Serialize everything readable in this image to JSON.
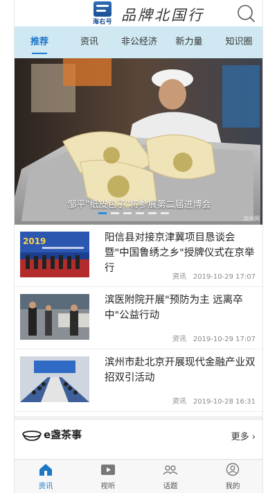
{
  "header": {
    "logo_text": "海右号",
    "slogan": "品牌北国行",
    "search_icon": "search-icon"
  },
  "tabs": [
    {
      "label": "推荐",
      "active": true
    },
    {
      "label": "资讯",
      "active": false
    },
    {
      "label": "非公经济",
      "active": false
    },
    {
      "label": "新力量",
      "active": false
    },
    {
      "label": "知识圈",
      "active": false
    }
  ],
  "banner": {
    "caption": "邹平\"纸皮包子\"将参展第二届进博会",
    "source": "滨州网",
    "slide_count": 6,
    "active_slide": 1
  },
  "news": [
    {
      "title": "阳信县对接京津冀项目恳谈会暨\"中国鲁绣之乡\"授牌仪式在京举行",
      "category": "资讯",
      "time": "2019-10-29 17:07",
      "thumb_text": "2019"
    },
    {
      "title": "滨医附院开展\"预防为主 远离卒中\"公益行动",
      "category": "资讯",
      "time": "2019-10-29 17:07"
    },
    {
      "title": "滨州市赴北京开展现代金融产业双招双引活动",
      "category": "资讯",
      "time": "2019-10-28 16:31"
    }
  ],
  "section": {
    "title": "e盏茶事",
    "more": "更多",
    "icon": "teacup-icon"
  },
  "bottom_nav": [
    {
      "label": "资讯",
      "icon": "home-icon",
      "active": true
    },
    {
      "label": "视听",
      "icon": "video-icon",
      "active": false
    },
    {
      "label": "话题",
      "icon": "topic-icon",
      "active": false
    },
    {
      "label": "我的",
      "icon": "profile-icon",
      "active": false
    }
  ],
  "colors": {
    "accent": "#1c76c8",
    "tab_bar": "#cfe8f2",
    "brand_blue": "#1b4f95"
  }
}
